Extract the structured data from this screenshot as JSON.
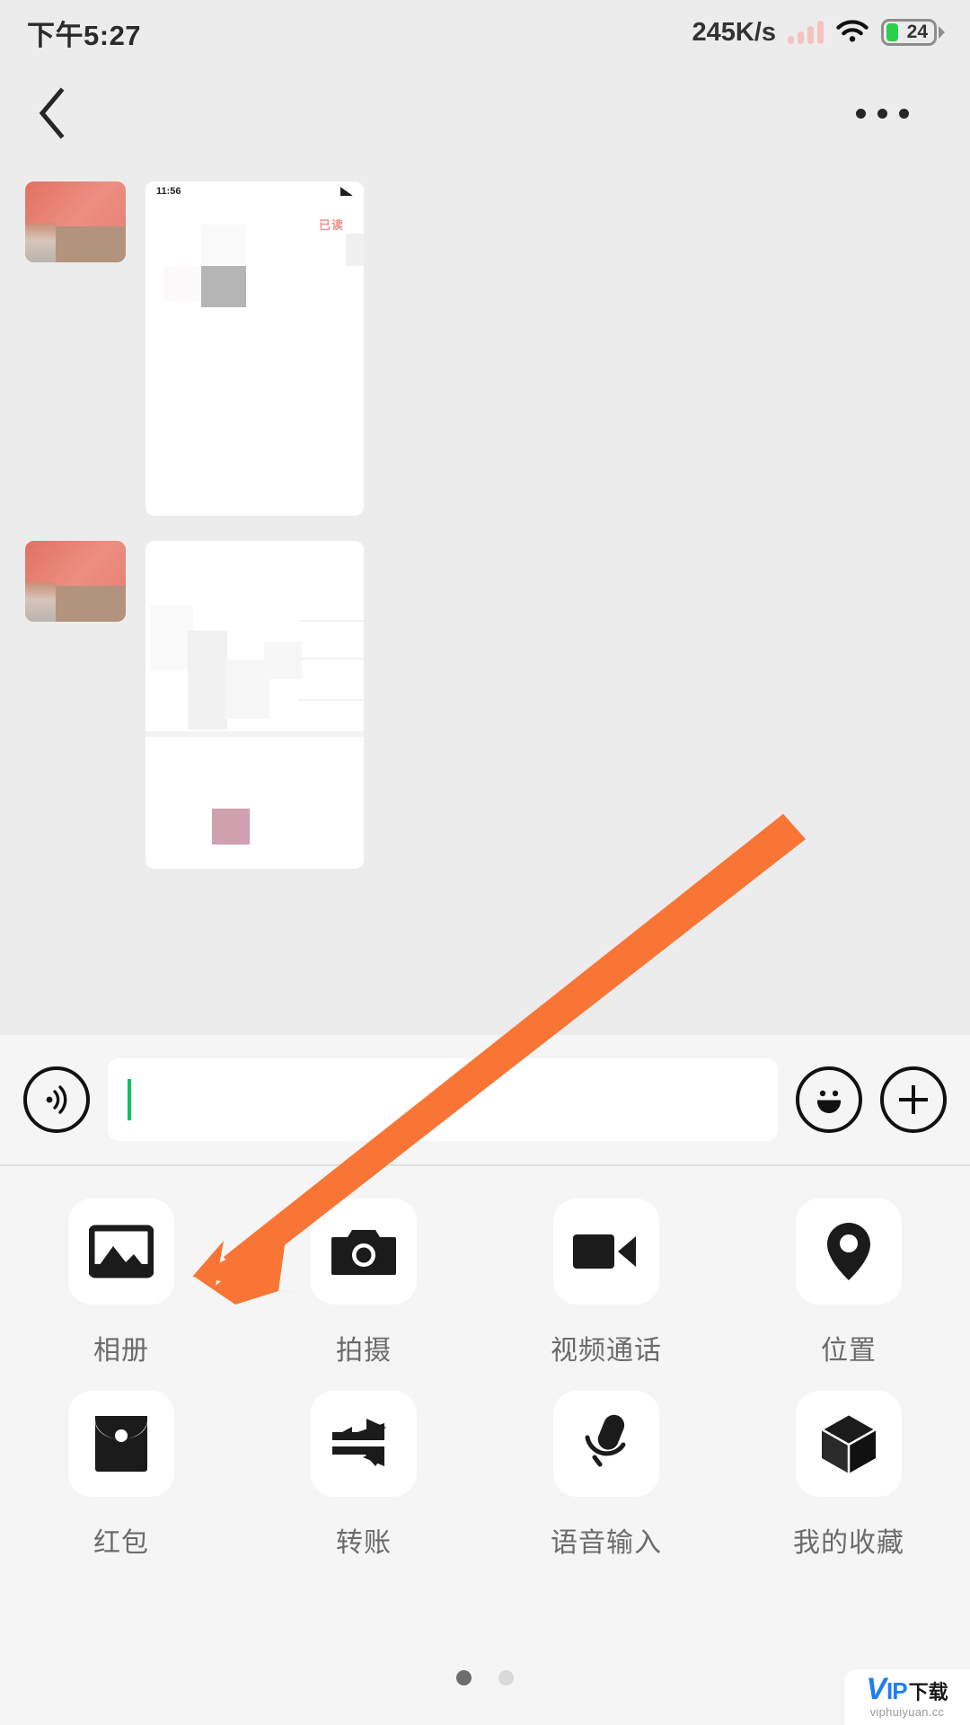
{
  "statusbar": {
    "time": "下午5:27",
    "net_speed": "245K/s",
    "battery_level": "24",
    "signal_icon": "signal-bars-icon",
    "wifi_icon": "wifi-icon",
    "battery_icon": "battery-icon"
  },
  "navbar": {
    "back_icon": "chevron-left-icon",
    "more_icon": "more-horizontal-icon"
  },
  "chat": {
    "messages": [
      {
        "sender": "contact",
        "type": "image",
        "inner_time": "11:56",
        "inner_red_text": "已读"
      },
      {
        "sender": "contact",
        "type": "image",
        "inner_time": "",
        "inner_red_text": ""
      }
    ]
  },
  "inputbar": {
    "voice_icon": "voice-wave-icon",
    "input_value": "",
    "input_placeholder": "",
    "emoji_icon": "smiley-face-icon",
    "more_icon": "plus-circle-icon",
    "caret_color": "#07c160"
  },
  "panel": {
    "items": [
      {
        "label": "相册",
        "icon": "photo-album-icon"
      },
      {
        "label": "拍摄",
        "icon": "camera-icon"
      },
      {
        "label": "视频通话",
        "icon": "video-call-icon"
      },
      {
        "label": "位置",
        "icon": "location-pin-icon"
      },
      {
        "label": "红包",
        "icon": "red-packet-icon"
      },
      {
        "label": "转账",
        "icon": "transfer-arrows-icon"
      },
      {
        "label": "语音输入",
        "icon": "microphone-icon"
      },
      {
        "label": "我的收藏",
        "icon": "cube-favorites-icon"
      }
    ],
    "page_dots": [
      {
        "active": true
      },
      {
        "active": false
      }
    ]
  },
  "annotation": {
    "arrow_color": "#f97535",
    "arrow_name": "orange-pointer-arrow",
    "points_to": "相册"
  },
  "watermark": {
    "brand_v": "V",
    "brand_ip": "IP",
    "brand_cn": "下载",
    "url": "viphuiyuan.cc",
    "brand_color": "#1f7ff0"
  }
}
